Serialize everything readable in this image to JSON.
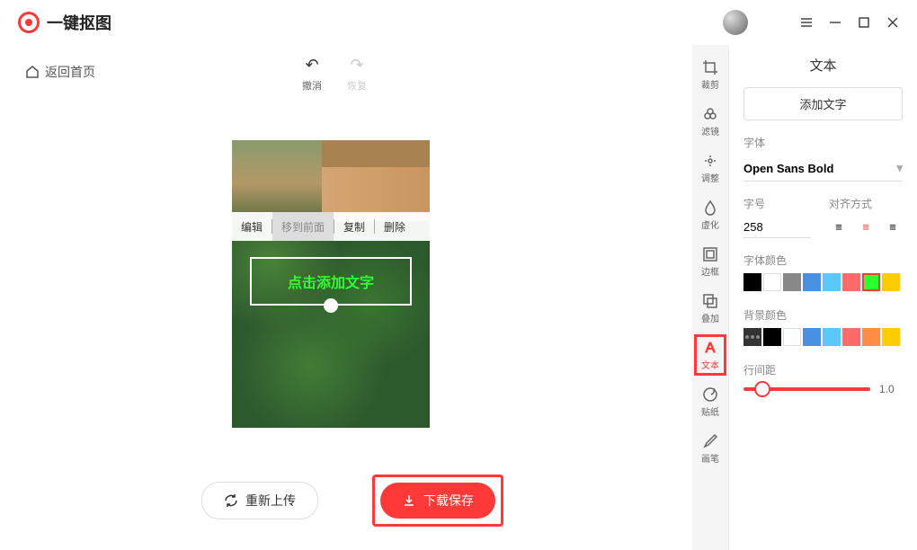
{
  "app": {
    "name": "一键抠图"
  },
  "nav": {
    "back_home": "返回首页"
  },
  "undo_redo": {
    "undo": "撤消",
    "redo": "恢复"
  },
  "context_menu": {
    "edit": "编辑",
    "bring_front": "移到前面",
    "copy": "复制",
    "delete": "删除"
  },
  "text_box": {
    "placeholder": "点击添加文字"
  },
  "bottom": {
    "reupload": "重新上传",
    "download": "下载保存"
  },
  "tools": {
    "crop": "裁剪",
    "filter": "滤镜",
    "adjust": "调整",
    "blur": "虚化",
    "border": "边框",
    "overlay": "叠加",
    "text": "文本",
    "sticker": "贴纸",
    "brush": "画笔"
  },
  "panel": {
    "title": "文本",
    "add_text": "添加文字",
    "font_label": "字体",
    "font_value": "Open Sans Bold",
    "size_label": "字号",
    "size_value": "258",
    "align_label": "对齐方式",
    "font_color_label": "字体颜色",
    "bg_color_label": "背景颜色",
    "line_spacing_label": "行间距",
    "line_spacing_value": "1.0",
    "font_colors": [
      "#000000",
      "#ffffff",
      "#888888",
      "#4a90e2",
      "#5ac8fa",
      "#ff6b6b",
      "#2eff2e",
      "#ffcc00"
    ],
    "bg_colors": [
      "#333333",
      "#000000",
      "#ffffff",
      "#4a90e2",
      "#5ac8fa",
      "#ff6b6b",
      "#ff8c42",
      "#ffcc00"
    ]
  }
}
